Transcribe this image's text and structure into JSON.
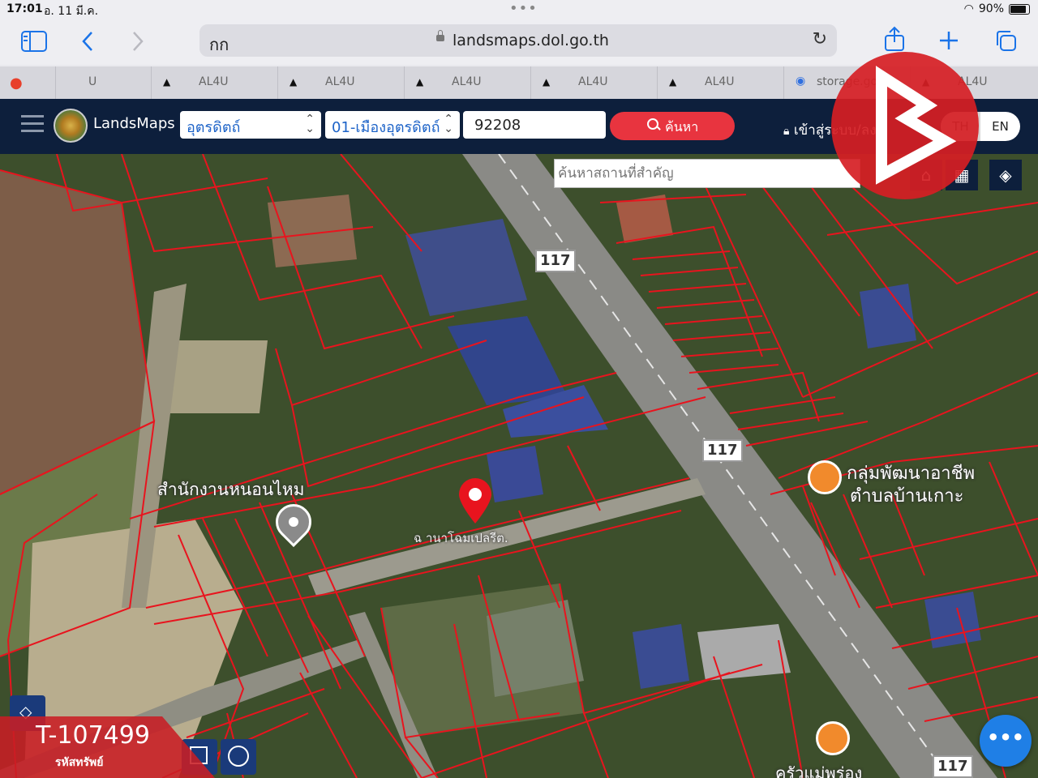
{
  "status_bar": {
    "time": "17:01",
    "date": "อ. 11 มี.ค.",
    "battery": "90%"
  },
  "browser": {
    "text_size_label": "กก",
    "url": "landsmaps.dol.go.th",
    "tabs": [
      {
        "icon": "map-pin-icon",
        "label": ""
      },
      {
        "icon": "",
        "label": "U"
      },
      {
        "icon": "triangle-icon",
        "label": "AL4U"
      },
      {
        "icon": "triangle-icon",
        "label": "AL4U"
      },
      {
        "icon": "triangle-icon",
        "label": "AL4U"
      },
      {
        "icon": "triangle-icon",
        "label": "AL4U"
      },
      {
        "icon": "triangle-icon",
        "label": "AL4U"
      },
      {
        "icon": "storage-icon",
        "label": "storage.go"
      },
      {
        "icon": "triangle-icon",
        "label": "AL4U"
      }
    ]
  },
  "header": {
    "brand": "LandsMaps",
    "province": "อุตรดิตถ์",
    "district": "01-เมืองอุตรดิตถ์",
    "parcel_number": "92208",
    "search_label": "ค้นหา",
    "login_label": "เข้าสู่ระบบ/ลง",
    "lang_th": "TH",
    "lang_en": "EN"
  },
  "map": {
    "place_search_placeholder": "ค้นหาสถานที่สำคัญ",
    "road_badges": [
      "117",
      "117",
      "117"
    ],
    "labels": {
      "office": "สำนักงานหนอนไหม",
      "group": "กลุ่มพัฒนาอาชีพ",
      "group_line2": "ตำบลบ้านเกาะ",
      "pin_note": "ฉ านาโฉมเปลรีต.",
      "restaurant": "ครัวแม่พร่อง"
    },
    "colors": {
      "parcel_line": "#e8141e",
      "pin": "#e8141e",
      "vegetation": "#3d4f2c",
      "road": "#8a8a86"
    }
  },
  "asset": {
    "code": "T-107499",
    "caption": "รหัสทรัพย์"
  },
  "fab_label": "•••"
}
